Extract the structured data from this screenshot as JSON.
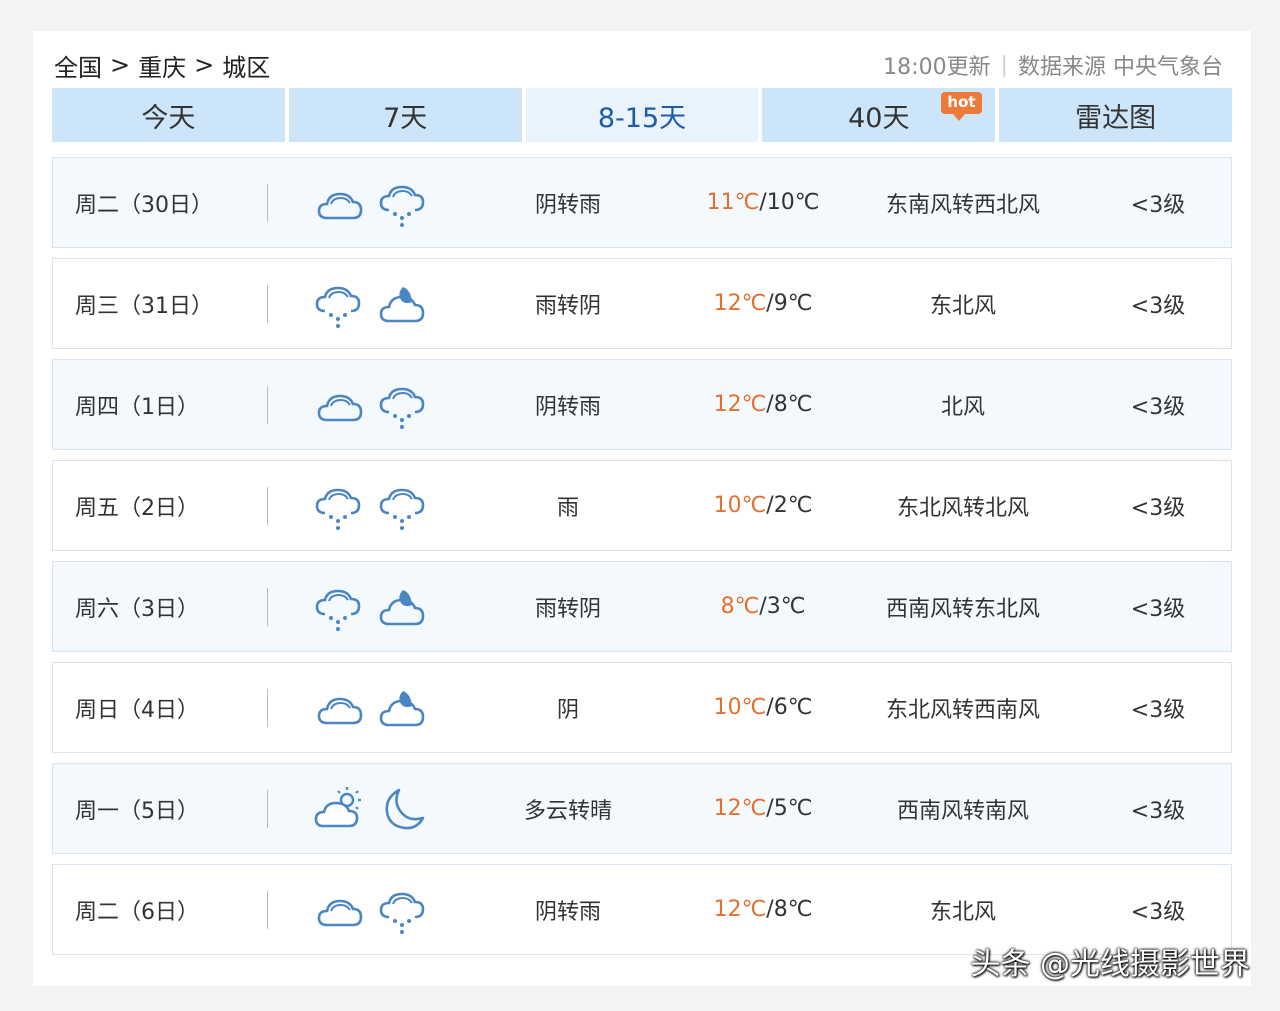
{
  "breadcrumb": {
    "country": "全国",
    "city": "重庆",
    "district": "城区",
    "separator": ">"
  },
  "meta": {
    "update": "18:00更新",
    "divider": "|",
    "source": "数据来源 中央气象台"
  },
  "tabs": [
    {
      "label": "今天"
    },
    {
      "label": "7天"
    },
    {
      "label": "8-15天",
      "active": true
    },
    {
      "label": "40天",
      "badge": "hot"
    },
    {
      "label": "雷达图"
    }
  ],
  "rows": [
    {
      "day": "周二（30日）",
      "icons": [
        "cloudy-icon",
        "rain-icon"
      ],
      "weather": "阴转雨",
      "high": "11℃",
      "low": "/10℃",
      "wind": "东南风转西北风",
      "level": "<3级"
    },
    {
      "day": "周三（31日）",
      "icons": [
        "rain-icon",
        "cloudy-night-icon"
      ],
      "weather": "雨转阴",
      "high": "12℃",
      "low": "/9℃",
      "wind": "东北风",
      "level": "<3级"
    },
    {
      "day": "周四（1日）",
      "icons": [
        "cloudy-icon",
        "rain-icon"
      ],
      "weather": "阴转雨",
      "high": "12℃",
      "low": "/8℃",
      "wind": "北风",
      "level": "<3级"
    },
    {
      "day": "周五（2日）",
      "icons": [
        "rain-icon",
        "rain-icon"
      ],
      "weather": "雨",
      "high": "10℃",
      "low": "/2℃",
      "wind": "东北风转北风",
      "level": "<3级"
    },
    {
      "day": "周六（3日）",
      "icons": [
        "rain-icon",
        "cloudy-night-icon"
      ],
      "weather": "雨转阴",
      "high": "8℃",
      "low": "/3℃",
      "wind": "西南风转东北风",
      "level": "<3级"
    },
    {
      "day": "周日（4日）",
      "icons": [
        "cloudy-icon",
        "cloudy-night-icon"
      ],
      "weather": "阴",
      "high": "10℃",
      "low": "/6℃",
      "wind": "东北风转西南风",
      "level": "<3级"
    },
    {
      "day": "周一（5日）",
      "icons": [
        "partly-cloudy-day-icon",
        "moon-icon"
      ],
      "weather": "多云转晴",
      "high": "12℃",
      "low": "/5℃",
      "wind": "西南风转南风",
      "level": "<3级"
    },
    {
      "day": "周二（6日）",
      "icons": [
        "cloudy-icon",
        "rain-icon"
      ],
      "weather": "阴转雨",
      "high": "12℃",
      "low": "/8℃",
      "wind": "东北风",
      "level": "<3级"
    }
  ],
  "watermark": "头条 @光线摄影世界",
  "colors": {
    "accent": "#1f5ba8",
    "high_temp": "#e2712f",
    "tab_bg": "#cde5f8",
    "icon": "#4a86c2"
  }
}
